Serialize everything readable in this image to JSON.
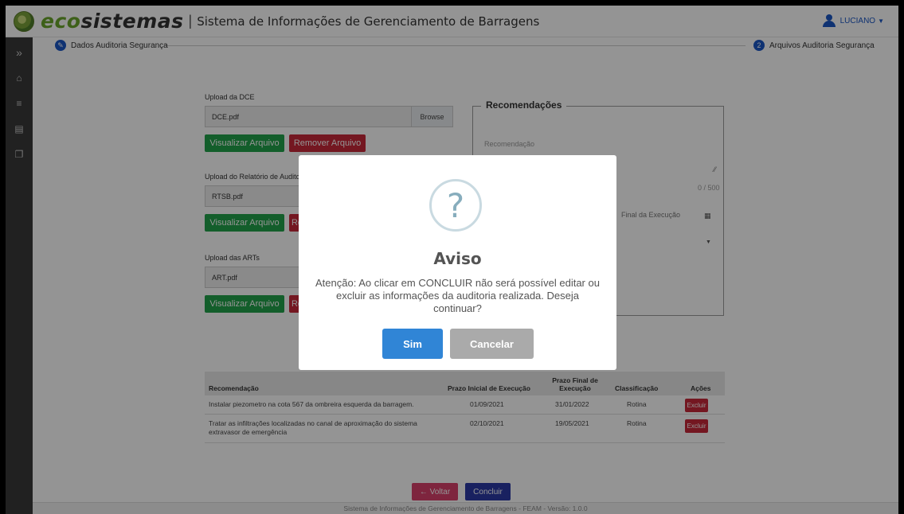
{
  "header": {
    "brand_eco": "eco",
    "brand_sistemas": "sistemas",
    "separator": "|",
    "system_title": "Sistema de Informações de Gerenciamento de Barragens",
    "user_name": "LUCIANO",
    "user_icon": "user-icon",
    "caret_icon": "caret-down-icon"
  },
  "sidebar": {
    "items": [
      {
        "icon": "chevron-double-right-icon",
        "glyph": "»"
      },
      {
        "icon": "home-icon",
        "glyph": "⌂"
      },
      {
        "icon": "menu-icon",
        "glyph": "≡"
      },
      {
        "icon": "card-icon",
        "glyph": "▤"
      },
      {
        "icon": "copy-icon",
        "glyph": "❐"
      }
    ]
  },
  "stepper": {
    "step1_glyph": "✎",
    "step1_label": "Dados Auditoria Segurança",
    "step2_number": "2",
    "step2_label": "Arquivos Auditoria Segurança"
  },
  "uploads": {
    "dce": {
      "label": "Upload da DCE",
      "file": "DCE.pdf",
      "browse": "Browse",
      "view": "Visualizar Arquivo",
      "remove": "Remover Arquivo"
    },
    "rtsb": {
      "label": "Upload do Relatório de Auditoria",
      "file": "RTSB.pdf",
      "view": "Visualizar Arquivo",
      "remove_partial": "Re"
    },
    "arts": {
      "label": "Upload das ARTs",
      "file": "ART.pdf",
      "view": "Visualizar Arquivo",
      "remove_partial": "Re"
    }
  },
  "recomendacoes": {
    "legend": "Recomendações",
    "placeholder": "Recomendação",
    "counter": "0 / 500",
    "prazo_final": "Final da Execução",
    "calendar_icon": "calendar-icon",
    "dropdown_icon": "caret-down-icon",
    "resize_icon": "resize-handle-icon"
  },
  "table": {
    "headers": [
      "Recomendação",
      "Prazo Inicial de Execução",
      "Prazo Final de Execução",
      "Classificação",
      "Ações"
    ],
    "rows": [
      {
        "recomendacao": "Instalar piezometro na cota 567 da ombreira esquerda da barragem.",
        "inicio": "01/09/2021",
        "fim": "31/01/2022",
        "classificacao": "Rotina",
        "acao": "Excluir"
      },
      {
        "recomendacao": "Tratar as infiltrações localizadas no canal de aproximação do sistema extravasor de emergência",
        "inicio": "02/10/2021",
        "fim": "19/05/2021",
        "classificacao": "Rotina",
        "acao": "Excluir"
      }
    ]
  },
  "actions": {
    "voltar": "← Voltar",
    "concluir": "Concluir"
  },
  "footer": {
    "text": "Sistema de Informações de Gerenciamento de Barragens - FEAM - Versão: 1.0.0"
  },
  "modal": {
    "icon": "question-icon",
    "glyph": "?",
    "title": "Aviso",
    "message": "Atenção: Ao clicar em CONCLUIR não será possível editar ou excluir as informações da auditoria realizada. Deseja continuar?",
    "confirm": "Sim",
    "cancel": "Cancelar"
  }
}
